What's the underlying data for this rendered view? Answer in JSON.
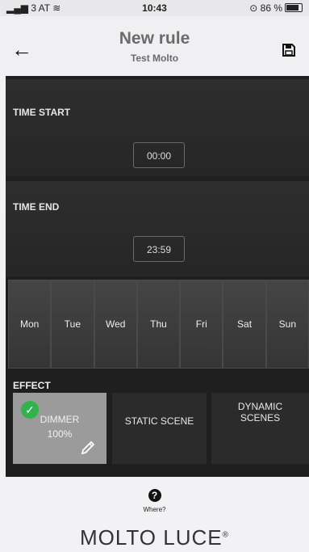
{
  "status": {
    "left": "3 AT",
    "time": "10:43",
    "battery": "86 %"
  },
  "header": {
    "title": "New rule",
    "subtitle": "Test Molto"
  },
  "time_start": {
    "label": "TIME START",
    "value": "00:00"
  },
  "time_end": {
    "label": "TIME END",
    "value": "23:59"
  },
  "days": [
    "Mon",
    "Tue",
    "Wed",
    "Thu",
    "Fri",
    "Sat",
    "Sun"
  ],
  "effect": {
    "label": "EFFECT",
    "dimmer": {
      "name": "DIMMER",
      "value": "100%"
    },
    "static": "STATIC SCENE",
    "dynamic": {
      "line1": "DYNAMIC",
      "line2": "SCENES"
    }
  },
  "footer": {
    "help": "Where?",
    "logo": "MOLTO LUCE",
    "logo_mark": "®"
  },
  "colors": {
    "check": "#2fb34a",
    "panel": "#2e2e2e",
    "dimmer_selected": "#9b9b9b"
  },
  "icons": {
    "back": "arrow-left-icon",
    "save": "save-icon",
    "help": "question-icon",
    "edit": "pencil-icon",
    "check": "check-icon"
  }
}
